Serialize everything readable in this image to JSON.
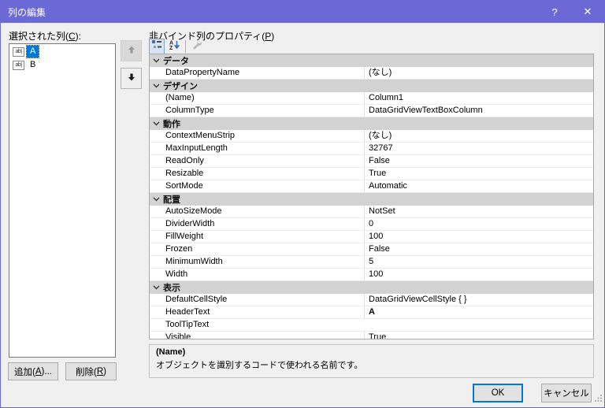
{
  "colors": {
    "titlebar": "#6b69d6",
    "selection": "#0078d7",
    "category_bg": "#d2d2d2",
    "accent": "#0078d7"
  },
  "window": {
    "title": "列の編集",
    "help": "?",
    "close": "✕"
  },
  "left_panel": {
    "label": "選択された列(C):",
    "item_icon_glyph": "ab|",
    "items": [
      {
        "name": "A",
        "selected": true
      },
      {
        "name": "B",
        "selected": false
      }
    ],
    "add_button": "追加(A)...",
    "remove_button": "削除(R)"
  },
  "property_panel": {
    "label": "非バインド列のプロパティ(P)",
    "toolbar": {
      "buttons": [
        {
          "icon": "categorized-icon",
          "pressed": true
        },
        {
          "icon": "alphabetical-sort-icon",
          "pressed": false
        },
        {
          "icon": "property-pages-icon",
          "pressed": false,
          "disabled": true
        }
      ]
    },
    "categories": [
      {
        "name": "データ",
        "rows": [
          {
            "name": "DataPropertyName",
            "value": "(なし)"
          }
        ]
      },
      {
        "name": "デザイン",
        "rows": [
          {
            "name": "(Name)",
            "value": "Column1"
          },
          {
            "name": "ColumnType",
            "value": "DataGridViewTextBoxColumn"
          }
        ]
      },
      {
        "name": "動作",
        "rows": [
          {
            "name": "ContextMenuStrip",
            "value": "(なし)"
          },
          {
            "name": "MaxInputLength",
            "value": "32767"
          },
          {
            "name": "ReadOnly",
            "value": "False"
          },
          {
            "name": "Resizable",
            "value": "True"
          },
          {
            "name": "SortMode",
            "value": "Automatic"
          }
        ]
      },
      {
        "name": "配置",
        "rows": [
          {
            "name": "AutoSizeMode",
            "value": "NotSet"
          },
          {
            "name": "DividerWidth",
            "value": "0"
          },
          {
            "name": "FillWeight",
            "value": "100"
          },
          {
            "name": "Frozen",
            "value": "False"
          },
          {
            "name": "MinimumWidth",
            "value": "5"
          },
          {
            "name": "Width",
            "value": "100"
          }
        ]
      },
      {
        "name": "表示",
        "rows": [
          {
            "name": "DefaultCellStyle",
            "value": "DataGridViewCellStyle { }"
          },
          {
            "name": "HeaderText",
            "value": "A",
            "bold": true
          },
          {
            "name": "ToolTipText",
            "value": ""
          },
          {
            "name": "Visible",
            "value": "True"
          }
        ]
      }
    ],
    "description": {
      "title": "(Name)",
      "text": "オブジェクトを識別するコードで使われる名前です。"
    }
  },
  "footer": {
    "ok": "OK",
    "cancel": "キャンセル"
  }
}
